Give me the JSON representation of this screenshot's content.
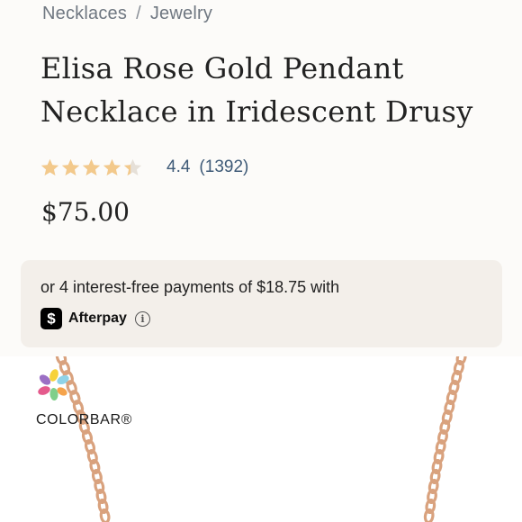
{
  "breadcrumb": {
    "items": [
      "Necklaces",
      "Jewelry"
    ],
    "separator": "/"
  },
  "product": {
    "title_lines": [
      "Elisa Rose Gold Pendant",
      "Necklace in Iridescent Drusy"
    ],
    "rating": {
      "value": "4.4",
      "count": "(1392)",
      "stars_filled": 4.4,
      "stars_total": 5,
      "star_color": "#f3c98b",
      "star_empty_color": "#e6e0d8"
    },
    "price": "$75.00"
  },
  "afterpay": {
    "text": "or 4 interest-free payments of $18.75 with",
    "brand": "Afterpay",
    "logo_icon": "afterpay-logo-icon",
    "info_icon": "info-icon",
    "info_glyph": "i"
  },
  "image": {
    "watermark": "COLORBAR®",
    "chain_color": "#d9a27e"
  }
}
